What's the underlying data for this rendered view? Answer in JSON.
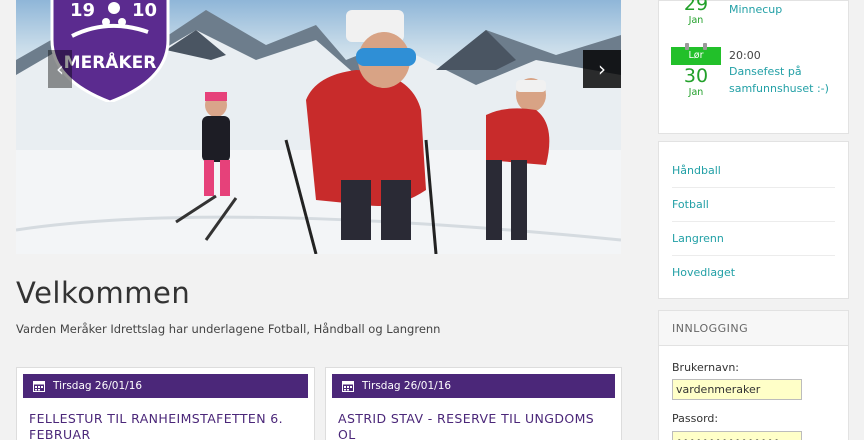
{
  "hero": {
    "logo_year_left": "19",
    "logo_year_right": "10",
    "logo_name": "MERÅKER",
    "prev_label": "‹",
    "next_label": "›"
  },
  "welcome": {
    "title": "Velkommen",
    "text": "Varden Meråker Idrettslag har underlagene Fotball, Håndball og Langrenn"
  },
  "news": [
    {
      "date": "Tirsdag 26/01/16",
      "headline": "FELLESTUR TIL RANHEIMSTAFETTEN 6. FEBRUAR"
    },
    {
      "date": "Tirsdag 26/01/16",
      "headline": "ASTRID STAV - RESERVE TIL UNGDOMS OL"
    }
  ],
  "events": [
    {
      "day": "29",
      "month": "Jan",
      "time": "",
      "title": "Minnecup"
    },
    {
      "weekday": "Lør",
      "day": "30",
      "month": "Jan",
      "time": "20:00",
      "title": "Dansefest på samfunnshuset :-)"
    }
  ],
  "sports": [
    "Håndball",
    "Fotball",
    "Langrenn",
    "Hovedlaget"
  ],
  "login": {
    "header": "INNLOGGING",
    "username_label": "Brukernavn:",
    "username_value": "vardenmeraker",
    "password_label": "Passord:",
    "password_value": "••••••••••••••••"
  },
  "colors": {
    "brand_purple": "#4b2779",
    "event_green": "#22c02a",
    "link_teal": "#22a0a6"
  }
}
